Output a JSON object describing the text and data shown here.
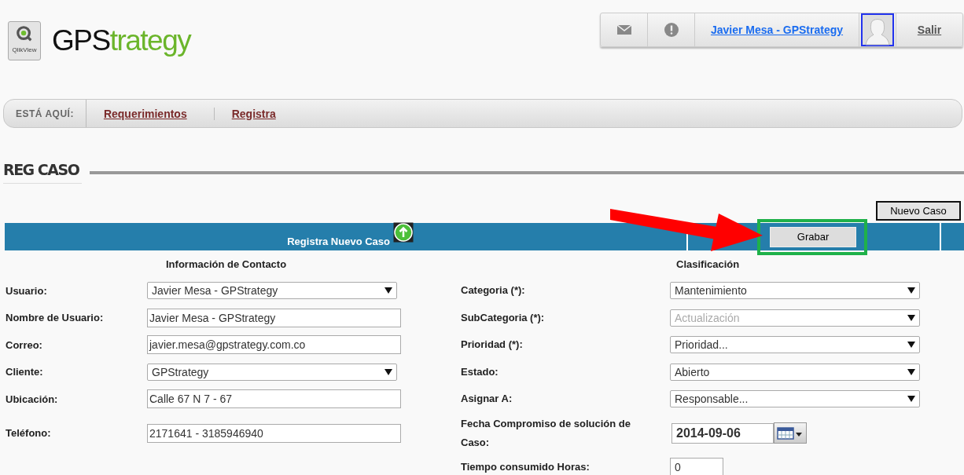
{
  "logo": {
    "badge_text": "QlikView",
    "brand_dark": "GPS",
    "brand_green": "trategy"
  },
  "top_bar": {
    "user_link": "Javier Mesa - GPStrategy",
    "logout": "Salir"
  },
  "breadcrumb": {
    "label": "ESTÁ AQUÍ:",
    "items": [
      "Requerimientos",
      "Registra"
    ]
  },
  "page_title": "REG CASO",
  "new_case_button": "Nuevo Caso",
  "form_bar": {
    "title": "Registra Nuevo Caso",
    "save_button": "Grabar",
    "highlighted": true
  },
  "contact": {
    "heading": "Información de Contacto",
    "fields": [
      {
        "label": "Usuario:",
        "kind": "select",
        "value": "Javier Mesa - GPStrategy",
        "disabled": false
      },
      {
        "label": "Nombre de Usuario:",
        "kind": "text",
        "value": "Javier Mesa - GPStrategy",
        "disabled": false
      },
      {
        "label": "Correo:",
        "kind": "text",
        "value": "javier.mesa@gpstrategy.com.co",
        "disabled": false
      },
      {
        "label": "Cliente:",
        "kind": "select",
        "value": "GPStrategy",
        "disabled": false
      },
      {
        "label": "Ubicación:",
        "kind": "text",
        "value": "Calle 67 N 7 - 67",
        "disabled": false
      },
      {
        "label": "Teléfono:",
        "kind": "text",
        "value": "2171641 - 3185946940",
        "disabled": false
      }
    ]
  },
  "classification": {
    "heading": "Clasificación",
    "fields": [
      {
        "label": "Categoria (*):",
        "kind": "select",
        "value": "Mantenimiento",
        "disabled": false
      },
      {
        "label": "SubCategoria (*):",
        "kind": "select",
        "value": "Actualización",
        "disabled": true
      },
      {
        "label": "Prioridad (*):",
        "kind": "select",
        "value": "Prioridad...",
        "disabled": false
      },
      {
        "label": "Estado:",
        "kind": "select",
        "value": "Abierto",
        "disabled": false
      },
      {
        "label": "Asignar A:",
        "kind": "select",
        "value": "Responsable...",
        "disabled": false
      },
      {
        "label": "Fecha Compromiso de solución de Caso:",
        "kind": "date",
        "value": "2014-09-06",
        "disabled": false
      },
      {
        "label": "Tiempo consumido Horas:",
        "kind": "short",
        "value": "0",
        "disabled": false
      }
    ]
  }
}
